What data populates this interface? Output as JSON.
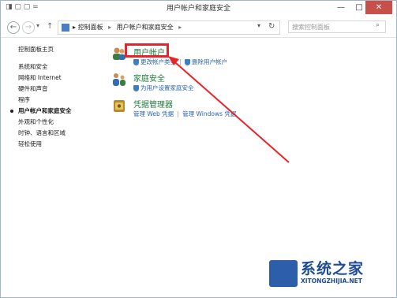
{
  "window": {
    "title": "用户帐户和家庭安全",
    "title_left": "◨ ▢ ▢ =",
    "minimize_label": "—",
    "maximize_label": "□",
    "close_label": "✕"
  },
  "addressbar": {
    "back_label": "←",
    "forward_label": "→",
    "history_label": "▾",
    "up_label": "↑",
    "crumb1": "控制面板",
    "crumb2": "用户帐户和家庭安全",
    "crumb_sep": "▸",
    "dropdown_label": "▾",
    "refresh_label": "↻",
    "search_placeholder": "搜索控制面板",
    "search_icon": "⌕"
  },
  "sidebar": {
    "home": "控制面板主页",
    "items": [
      "系统和安全",
      "网络和 Internet",
      "硬件和声音",
      "程序",
      "用户帐户和家庭安全",
      "外观和个性化",
      "时钟、语言和区域",
      "轻松使用"
    ]
  },
  "categories": {
    "user_accounts": {
      "title": "用户帐户",
      "link1": "更改帐户类型",
      "link2": "删除用户帐户"
    },
    "family_safety": {
      "title": "家庭安全",
      "link1": "为用户设置家庭安全"
    },
    "credential_manager": {
      "title": "凭据管理器",
      "link1": "管理 Web 凭据",
      "link2": "管理 Windows 凭据"
    }
  },
  "watermark": {
    "text": "系统之家",
    "url": "XITONGZHIJIA.NET"
  },
  "colors": {
    "category_title": "#1f7a3b",
    "link": "#2a64b1",
    "highlight": "#e8242a",
    "watermark": "#1e4c94"
  }
}
